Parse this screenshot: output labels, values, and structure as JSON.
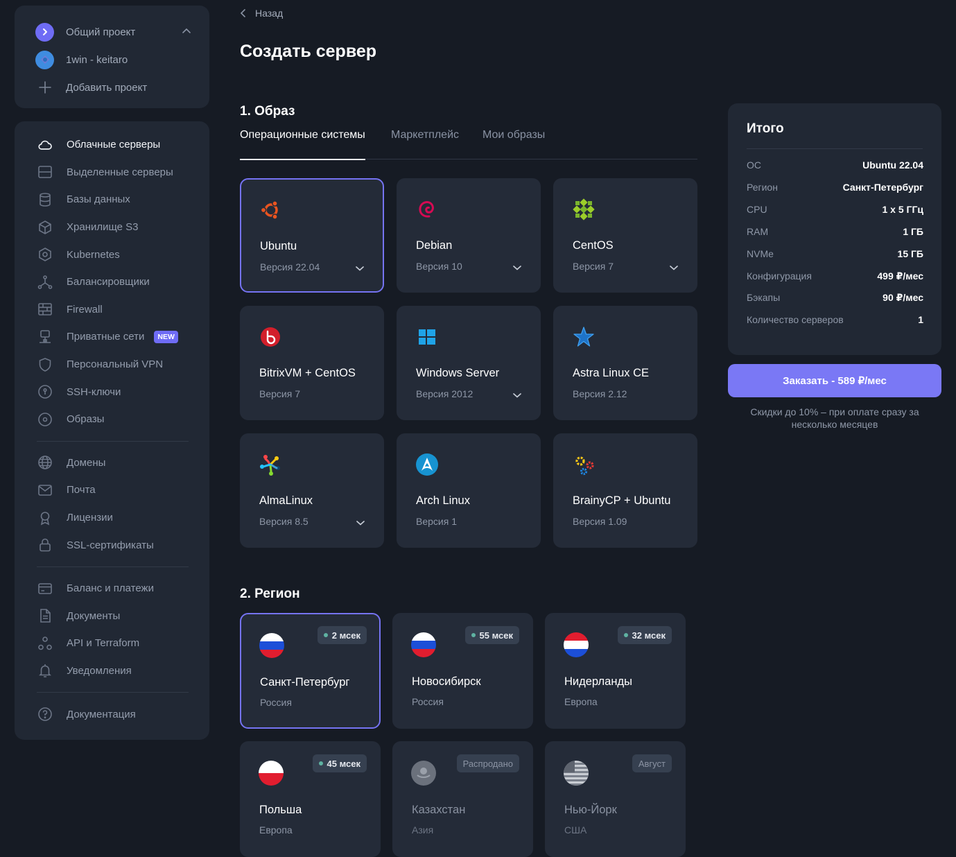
{
  "projects": [
    {
      "label": "Общий проект"
    },
    {
      "label": "1win - keitaro"
    },
    {
      "label": "Добавить проект"
    }
  ],
  "nav": {
    "group1": [
      {
        "label": "Облачные серверы",
        "icon": "cloud-icon"
      },
      {
        "label": "Выделенные серверы",
        "icon": "server-icon"
      },
      {
        "label": "Базы данных",
        "icon": "database-icon"
      },
      {
        "label": "Хранилище S3",
        "icon": "cube-icon"
      },
      {
        "label": "Kubernetes",
        "icon": "kubernetes-icon"
      },
      {
        "label": "Балансировщики",
        "icon": "balancer-icon"
      },
      {
        "label": "Firewall",
        "icon": "firewall-icon"
      },
      {
        "label": "Приватные сети",
        "icon": "network-icon",
        "badge": "NEW"
      },
      {
        "label": "Персональный VPN",
        "icon": "shield-icon"
      },
      {
        "label": "SSH-ключи",
        "icon": "key-icon"
      },
      {
        "label": "Образы",
        "icon": "disc-icon"
      }
    ],
    "group2": [
      {
        "label": "Домены",
        "icon": "globe-icon"
      },
      {
        "label": "Почта",
        "icon": "mail-icon"
      },
      {
        "label": "Лицензии",
        "icon": "license-icon"
      },
      {
        "label": "SSL-сертификаты",
        "icon": "lock-icon"
      }
    ],
    "group3": [
      {
        "label": "Баланс и платежи",
        "icon": "card-icon"
      },
      {
        "label": "Документы",
        "icon": "document-icon"
      },
      {
        "label": "API и Terraform",
        "icon": "api-icon"
      },
      {
        "label": "Уведомления",
        "icon": "bell-icon"
      }
    ],
    "group4": [
      {
        "label": "Документация",
        "icon": "help-icon"
      }
    ]
  },
  "main": {
    "back_label": "Назад",
    "title": "Создать сервер",
    "section1": "1. Образ",
    "tabs": [
      {
        "label": "Операционные системы"
      },
      {
        "label": "Маркетплейс"
      },
      {
        "label": "Мои образы"
      }
    ],
    "os": [
      {
        "name": "Ubuntu",
        "version": "Версия 22.04",
        "icon": "ubuntu-icon"
      },
      {
        "name": "Debian",
        "version": "Версия 10",
        "icon": "debian-icon"
      },
      {
        "name": "CentOS",
        "version": "Версия 7",
        "icon": "centos-icon"
      },
      {
        "name": "BitrixVM + CentOS",
        "version": "Версия 7",
        "icon": "bitrix-icon"
      },
      {
        "name": "Windows Server",
        "version": "Версия 2012",
        "icon": "windows-icon"
      },
      {
        "name": "Astra Linux CE",
        "version": "Версия 2.12",
        "icon": "astra-icon"
      },
      {
        "name": "AlmaLinux",
        "version": "Версия 8.5",
        "icon": "almalinux-icon"
      },
      {
        "name": "Arch Linux",
        "version": "Версия 1",
        "icon": "arch-icon"
      },
      {
        "name": "BrainyCP + Ubuntu",
        "version": "Версия 1.09",
        "icon": "brainycp-icon"
      }
    ],
    "section2": "2. Регион",
    "regions": [
      {
        "name": "Санкт-Петербург",
        "country": "Россия",
        "badge": "2 мсек"
      },
      {
        "name": "Новосибирск",
        "country": "Россия",
        "badge": "55 мсек"
      },
      {
        "name": "Нидерланды",
        "country": "Европа",
        "badge": "32 мсек"
      },
      {
        "name": "Польша",
        "country": "Европа",
        "badge": "45 мсек"
      },
      {
        "name": "Казахстан",
        "country": "Азия",
        "badge": "Распродано"
      },
      {
        "name": "Нью-Йорк",
        "country": "США",
        "badge": "Август"
      }
    ]
  },
  "summary": {
    "title": "Итого",
    "rows": [
      {
        "key": "ОС",
        "value": "Ubuntu 22.04"
      },
      {
        "key": "Регион",
        "value": "Санкт-Петербург"
      },
      {
        "key": "CPU",
        "value": "1 x 5 ГГц"
      },
      {
        "key": "RAM",
        "value": "1 ГБ"
      },
      {
        "key": "NVMe",
        "value": "15 ГБ"
      },
      {
        "key": "Конфигурация",
        "value": "499 ₽/мес"
      },
      {
        "key": "Бэкапы",
        "value": "90 ₽/мес"
      },
      {
        "key": "Количество серверов",
        "value": "1"
      }
    ],
    "order_label": "Заказать - 589 ₽/мес",
    "discount_line1": "Скидки до 10% – при оплате сразу за",
    "discount_line2": "несколько месяцев"
  },
  "colors": {
    "background": "#161b24",
    "panel": "#212834",
    "card": "#242b38",
    "accent": "#7a78f5"
  }
}
